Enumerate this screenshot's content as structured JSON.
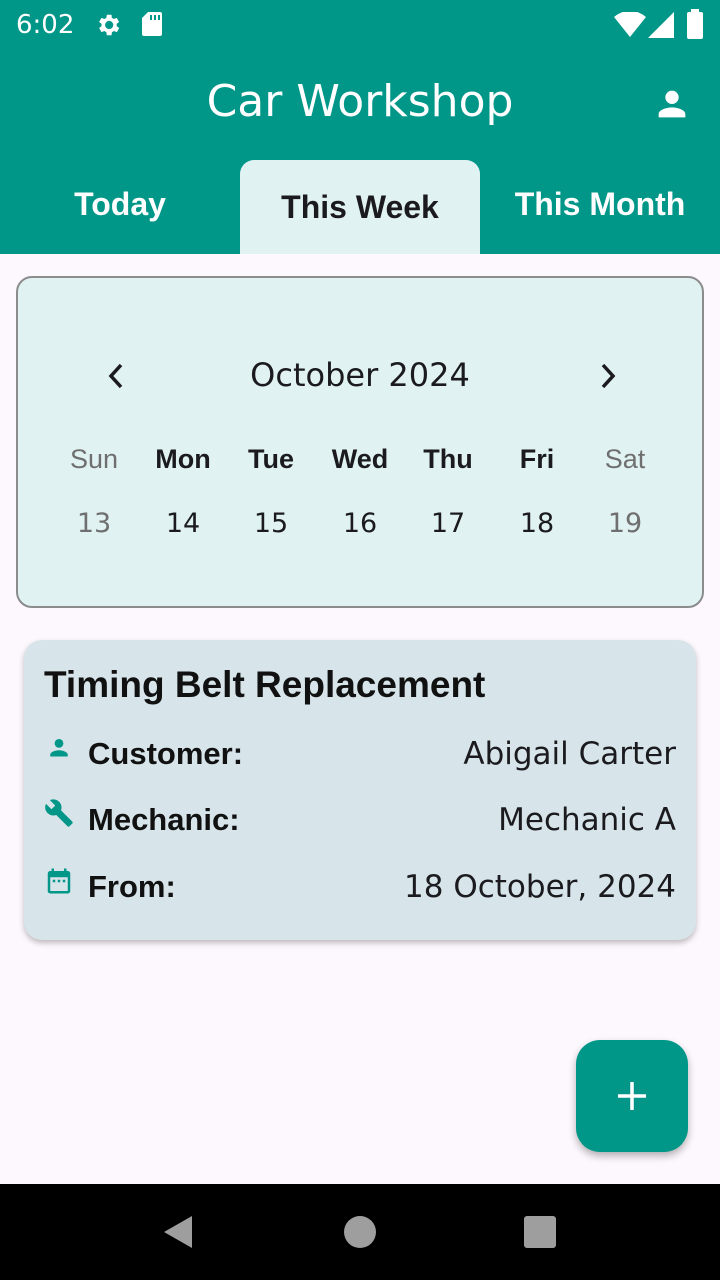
{
  "status_bar": {
    "time": "6:02",
    "icons": [
      "gear-icon",
      "sd-card-icon",
      "wifi-icon",
      "signal-icon",
      "battery-icon"
    ]
  },
  "app_bar": {
    "title": "Car Workshop",
    "profile_icon": "person-icon"
  },
  "tabs": [
    {
      "label": "Today",
      "active": false
    },
    {
      "label": "This Week",
      "active": true
    },
    {
      "label": "This Month",
      "active": false
    }
  ],
  "calendar": {
    "month_label": "October 2024",
    "weekdays": [
      "Sun",
      "Mon",
      "Tue",
      "Wed",
      "Thu",
      "Fri",
      "Sat"
    ],
    "days": [
      "13",
      "14",
      "15",
      "16",
      "17",
      "18",
      "19"
    ]
  },
  "job": {
    "title": "Timing Belt Replacement",
    "customer_label": "Customer:",
    "customer_value": "Abigail Carter",
    "mechanic_label": "Mechanic:",
    "mechanic_value": "Mechanic A",
    "from_label": "From:",
    "from_value": "18 October, 2024"
  },
  "fab": {
    "icon": "plus-icon"
  },
  "colors": {
    "primary": "#009688",
    "calendar_bg": "#e0f2f1",
    "card_bg": "#d7e5ea",
    "background": "#fdf8fd"
  }
}
